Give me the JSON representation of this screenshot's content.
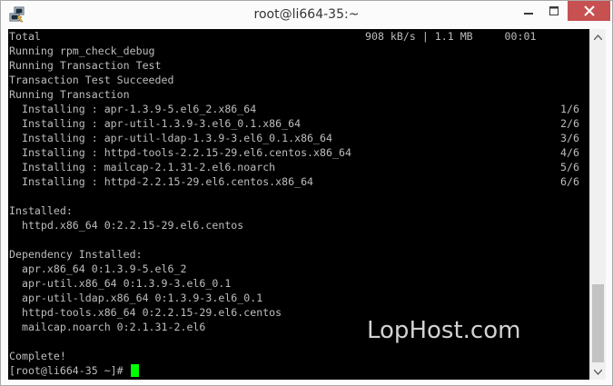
{
  "window": {
    "title": "root@li664-35:~",
    "icon": "putty-icon"
  },
  "controls": {
    "minimize_icon": "minimize-icon",
    "maximize_icon": "maximize-icon",
    "close_icon": "close-icon",
    "close_color": "#c75050"
  },
  "terminal": {
    "background": "#000000",
    "text_color": "#bdbdbd",
    "cursor_color": "#00ff00",
    "lines": [
      {
        "text": "Total",
        "right": "908 kB/s | 1.1 MB     00:01"
      },
      {
        "text": "Running rpm_check_debug",
        "right": ""
      },
      {
        "text": "Running Transaction Test",
        "right": ""
      },
      {
        "text": "Transaction Test Succeeded",
        "right": ""
      },
      {
        "text": "Running Transaction",
        "right": ""
      },
      {
        "text": "  Installing : apr-1.3.9-5.el6_2.x86_64",
        "right": "1/6"
      },
      {
        "text": "  Installing : apr-util-1.3.9-3.el6_0.1.x86_64",
        "right": "2/6"
      },
      {
        "text": "  Installing : apr-util-ldap-1.3.9-3.el6_0.1.x86_64",
        "right": "3/6"
      },
      {
        "text": "  Installing : httpd-tools-2.2.15-29.el6.centos.x86_64",
        "right": "4/6"
      },
      {
        "text": "  Installing : mailcap-2.1.31-2.el6.noarch",
        "right": "5/6"
      },
      {
        "text": "  Installing : httpd-2.2.15-29.el6.centos.x86_64",
        "right": "6/6"
      },
      {
        "text": "",
        "right": ""
      },
      {
        "text": "Installed:",
        "right": ""
      },
      {
        "text": "  httpd.x86_64 0:2.2.15-29.el6.centos",
        "right": ""
      },
      {
        "text": "",
        "right": ""
      },
      {
        "text": "Dependency Installed:",
        "right": ""
      },
      {
        "text": "  apr.x86_64 0:1.3.9-5.el6_2",
        "right": ""
      },
      {
        "text": "  apr-util.x86_64 0:1.3.9-3.el6_0.1",
        "right": ""
      },
      {
        "text": "  apr-util-ldap.x86_64 0:1.3.9-3.el6_0.1",
        "right": ""
      },
      {
        "text": "  httpd-tools.x86_64 0:2.2.15-29.el6.centos",
        "right": ""
      },
      {
        "text": "  mailcap.noarch 0:2.1.31-2.el6",
        "right": ""
      },
      {
        "text": "",
        "right": ""
      },
      {
        "text": "Complete!",
        "right": ""
      }
    ],
    "prompt": "[root@li664-35 ~]# ",
    "watermark": "LopHost.com"
  },
  "scrollbar": {
    "up_icon": "scroll-up-arrow-icon",
    "down_icon": "scroll-down-arrow-icon"
  }
}
